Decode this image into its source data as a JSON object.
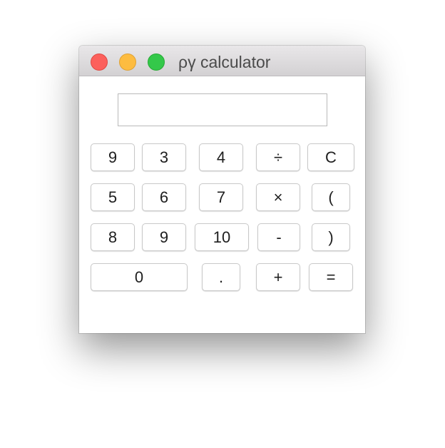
{
  "window": {
    "title": "ργ calculator"
  },
  "display": {
    "value": ""
  },
  "keypad": {
    "row1": [
      "9",
      "3",
      "4",
      "÷",
      "C"
    ],
    "row2": [
      "5",
      "6",
      "7",
      "×",
      "("
    ],
    "row3": [
      "8",
      "9",
      "10",
      "-",
      ")"
    ],
    "row4": [
      "0",
      ".",
      "+",
      "="
    ]
  },
  "colors": {
    "close": "#fc605c",
    "minimize": "#fdbc40",
    "maximize": "#34c84a"
  }
}
